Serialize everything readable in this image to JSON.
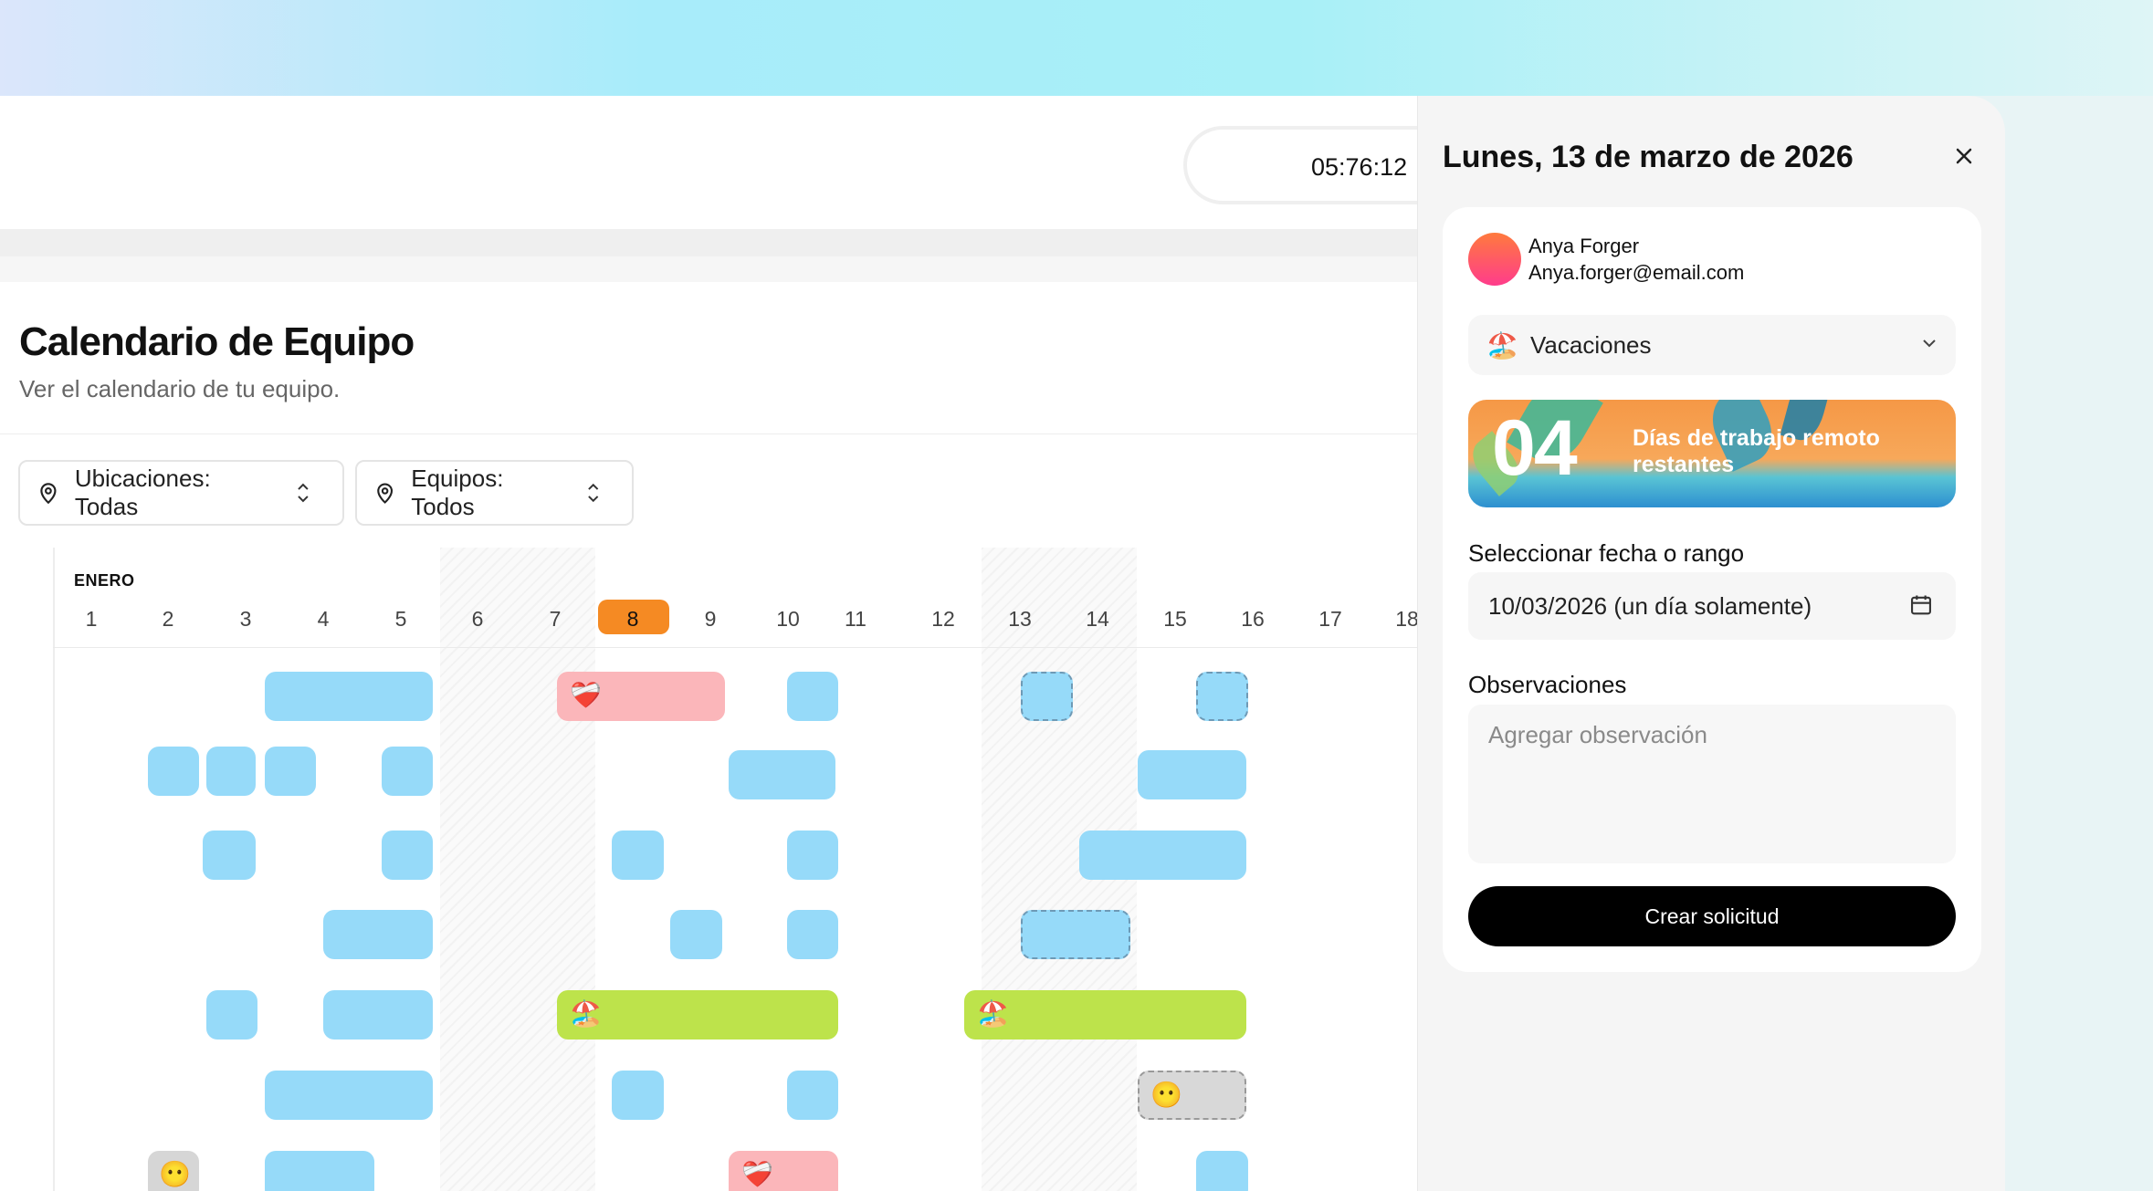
{
  "header": {
    "timer": "05:76:12"
  },
  "page": {
    "title": "Calendario de Equipo",
    "subtitle": "Ver el calendario de tu equipo."
  },
  "filters": [
    {
      "label": "Ubicaciones: Todas",
      "icon": "location-pin-icon"
    },
    {
      "label": "Equipos: Todos",
      "icon": "location-pin-icon"
    }
  ],
  "calendar": {
    "month": "ENERO",
    "days": [
      "1",
      "2",
      "3",
      "4",
      "5",
      "6",
      "7",
      "8",
      "9",
      "10",
      "11",
      "12",
      "13",
      "14",
      "15",
      "16",
      "17",
      "18"
    ],
    "today": "8",
    "colors": {
      "remote": "#96daf9",
      "sick": "#fbb6ba",
      "vacation": "#bde34b",
      "today": "#f58a23"
    },
    "emojis": {
      "sick": "❤️‍🩹",
      "vacation": "🏖️",
      "other": "😶"
    }
  },
  "panel": {
    "date_title": "Lunes, 13 de marzo de 2026",
    "user": {
      "name": "Anya Forger",
      "email": "Anya.forger@email.com"
    },
    "type_select": {
      "icon": "🏖️",
      "value": "Vacaciones"
    },
    "banner": {
      "number": "04",
      "text": "Días de trabajo remoto restantes"
    },
    "date_label": "Seleccionar fecha o rango",
    "date_value": "10/03/2026 (un día solamente)",
    "notes_label": "Observaciones",
    "notes_placeholder": "Agregar observación",
    "submit_label": "Crear solicitud",
    "accent": "#000000"
  }
}
